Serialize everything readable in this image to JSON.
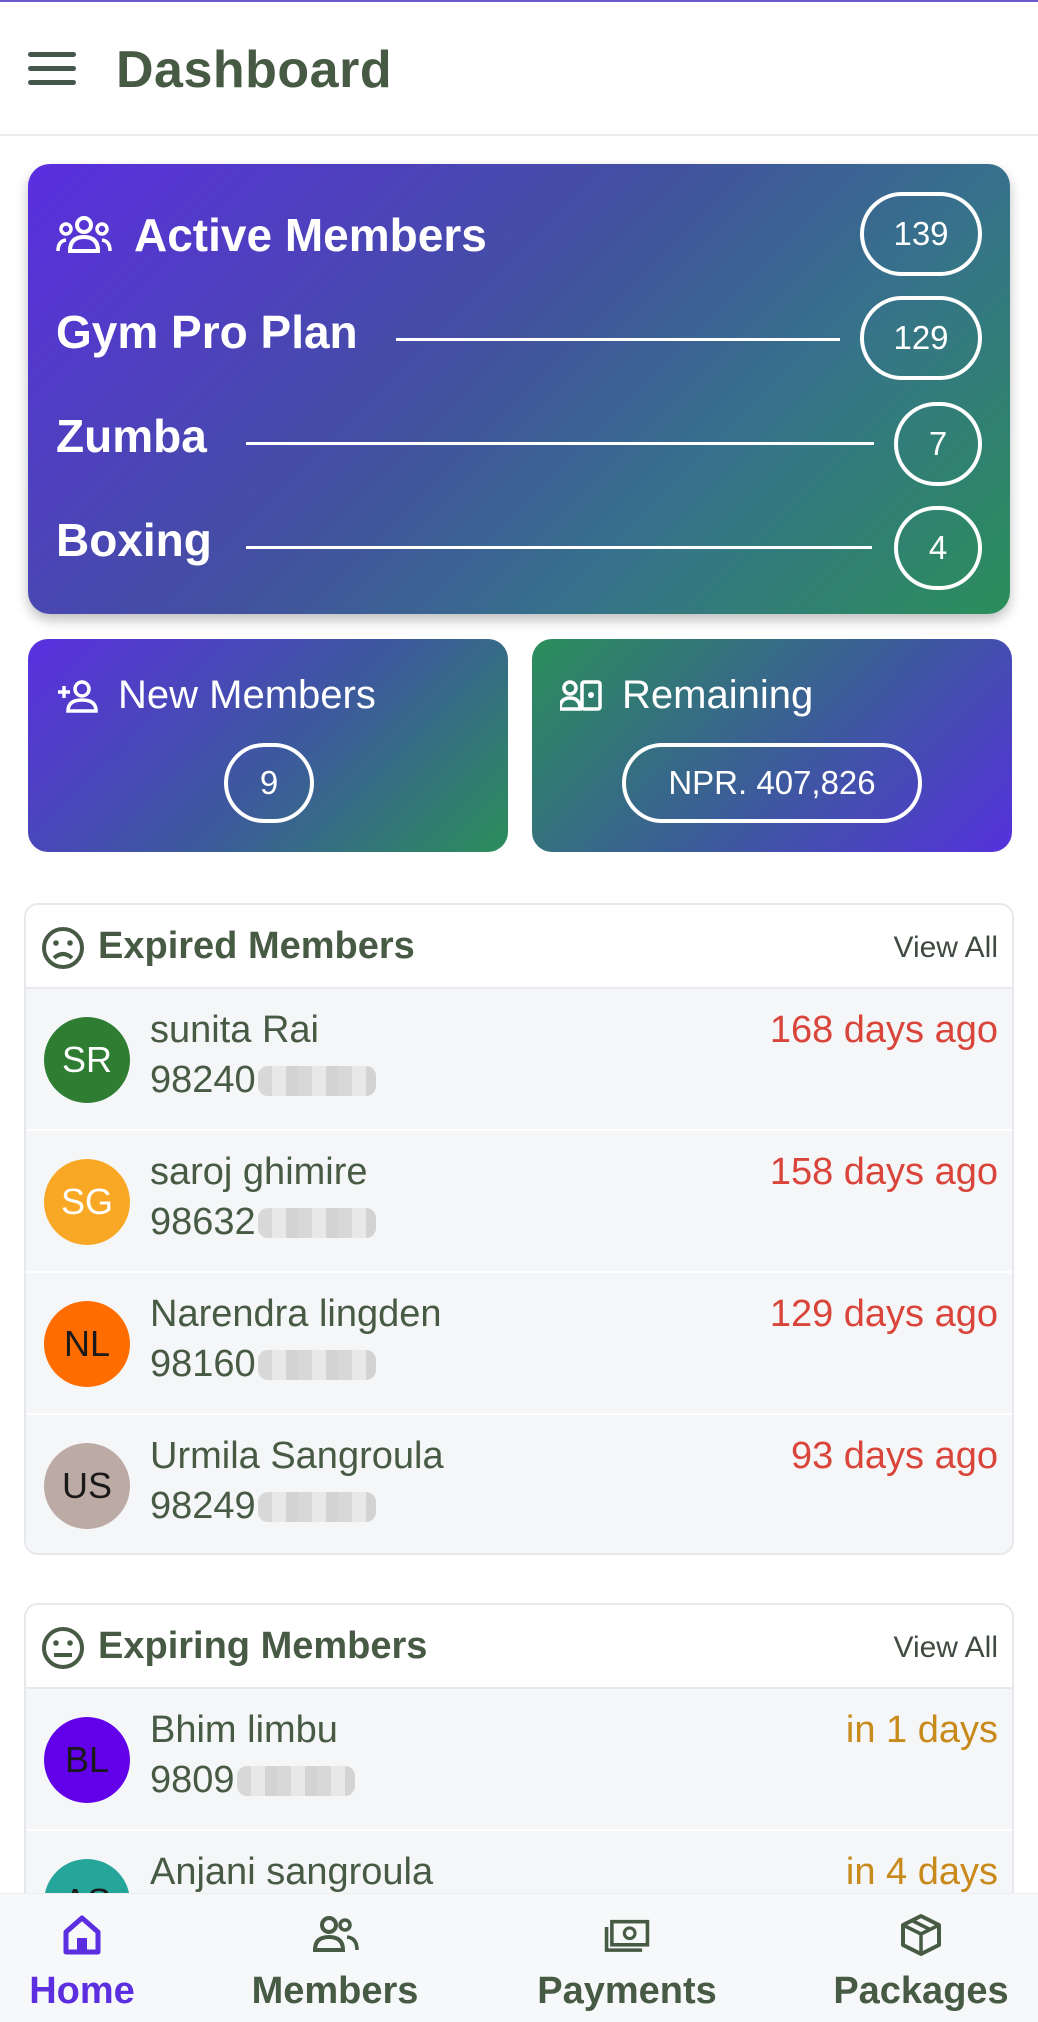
{
  "header": {
    "title": "Dashboard"
  },
  "active_members": {
    "title": "Active Members",
    "total": "139",
    "plans": [
      {
        "name": "Gym Pro Plan",
        "count": "129"
      },
      {
        "name": "Zumba",
        "count": "7"
      },
      {
        "name": "Boxing",
        "count": "4"
      }
    ]
  },
  "new_members": {
    "title": "New Members",
    "count": "9"
  },
  "remaining": {
    "title": "Remaining",
    "amount": "NPR. 407,826"
  },
  "expired": {
    "title": "Expired Members",
    "view_all": "View All",
    "members": [
      {
        "initials": "SR",
        "name": "sunita Rai",
        "phone": "98240",
        "days": "168 days ago",
        "color": "#2e7d32",
        "text_color": "#ffffff"
      },
      {
        "initials": "SG",
        "name": "saroj ghimire",
        "phone": "98632",
        "days": "158 days ago",
        "color": "#f9a825",
        "text_color": "#ffffff"
      },
      {
        "initials": "NL",
        "name": "Narendra lingden",
        "phone": "98160",
        "days": "129 days ago",
        "color": "#ff6d00",
        "text_color": "#1a1a1a"
      },
      {
        "initials": "US",
        "name": "Urmila Sangroula",
        "phone": "98249",
        "days": "93 days ago",
        "color": "#bcaaa4",
        "text_color": "#1a1a1a"
      }
    ]
  },
  "expiring": {
    "title": "Expiring Members",
    "view_all": "View All",
    "members": [
      {
        "initials": "BL",
        "name": "Bhim limbu",
        "phone": "9809",
        "days": "in 1 days",
        "color": "#6200ea",
        "text_color": "#1a1a1a"
      },
      {
        "initials": "AS",
        "name": "Anjani sangroula",
        "phone": "",
        "days": "in 4 days",
        "color": "#26a69a",
        "text_color": "#1a1a1a"
      }
    ]
  },
  "bottom_nav": [
    {
      "label": "Home",
      "icon": "home-icon",
      "active": true
    },
    {
      "label": "Members",
      "icon": "members-icon"
    },
    {
      "label": "Payments",
      "icon": "payments-icon"
    },
    {
      "label": "Packages",
      "icon": "packages-icon"
    }
  ],
  "colors": {
    "accent": "#5b2ee0",
    "expired": "#d9453a",
    "expiring": "#c98a1c"
  }
}
